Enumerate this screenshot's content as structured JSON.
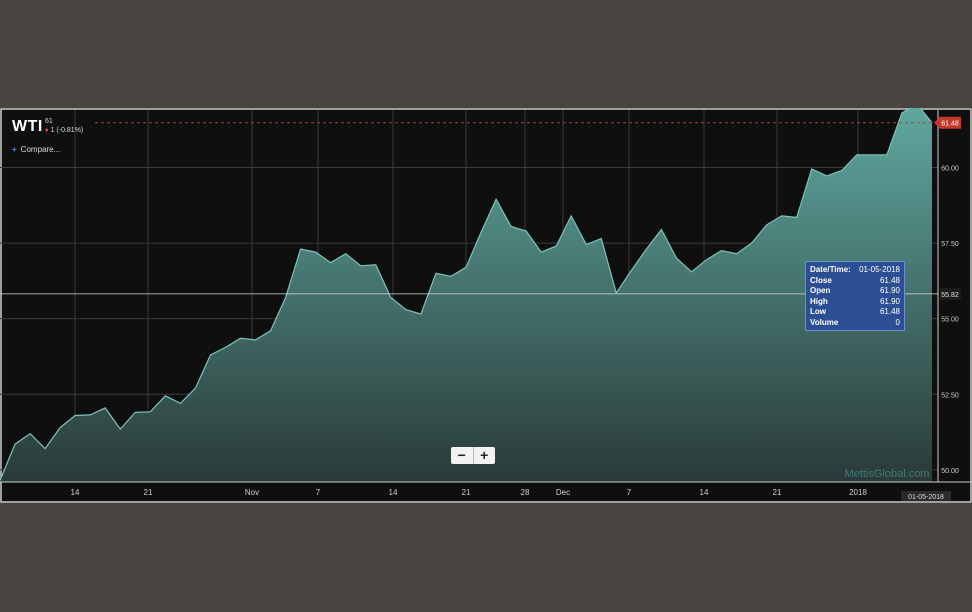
{
  "header": {
    "symbol": "WTI",
    "last": "61",
    "change": "1 (-0.81%)",
    "compare_label": "Compare..."
  },
  "zoom": {
    "out_label": "−",
    "in_label": "+"
  },
  "watermark": "MettisGlobal.com",
  "tooltip": {
    "rows": [
      {
        "key": "Date/Time:",
        "value": "01-05-2018"
      },
      {
        "key": "Close",
        "value": "61.48"
      },
      {
        "key": "Open",
        "value": "61.90"
      },
      {
        "key": "High",
        "value": "61.90"
      },
      {
        "key": "Low",
        "value": "61.48"
      },
      {
        "key": "Volume",
        "value": "0"
      }
    ]
  },
  "price_badge": "61.48",
  "crosshair_label": "55.82",
  "date_badge": "01-05-2018",
  "colors": {
    "area_top": "#5fa8a0",
    "area_bottom": "#2a3a38",
    "badge": "#c0392b",
    "tooltip_bg": "#2c4f94"
  },
  "chart_data": {
    "type": "area",
    "title": "",
    "xlabel": "",
    "ylabel": "",
    "ylim": [
      49.6,
      61.9
    ],
    "y_ticks": [
      "50.00",
      "52.50",
      "55.00",
      "57.50",
      "60.00"
    ],
    "x_ticks": [
      "14",
      "21",
      "Nov",
      "7",
      "14",
      "21",
      "28",
      "Dec",
      "7",
      "14",
      "21",
      "2018"
    ],
    "grid": true,
    "current_value": 61.48,
    "crosshair_value": 55.82,
    "values": [
      49.65,
      50.85,
      51.2,
      50.7,
      51.4,
      51.8,
      51.82,
      52.05,
      51.35,
      51.9,
      51.92,
      52.45,
      52.2,
      52.7,
      53.8,
      54.05,
      54.35,
      54.3,
      54.6,
      55.7,
      57.3,
      57.2,
      56.85,
      57.15,
      56.75,
      56.78,
      55.7,
      55.3,
      55.15,
      56.5,
      56.4,
      56.7,
      57.85,
      58.95,
      58.05,
      57.9,
      57.2,
      57.4,
      58.4,
      57.45,
      57.65,
      55.85,
      56.6,
      57.3,
      57.95,
      57.0,
      56.55,
      56.95,
      57.25,
      57.15,
      57.5,
      58.1,
      58.4,
      58.35,
      59.95,
      59.72,
      59.9,
      60.42,
      60.42,
      60.42,
      61.8,
      62.1,
      61.48
    ]
  }
}
